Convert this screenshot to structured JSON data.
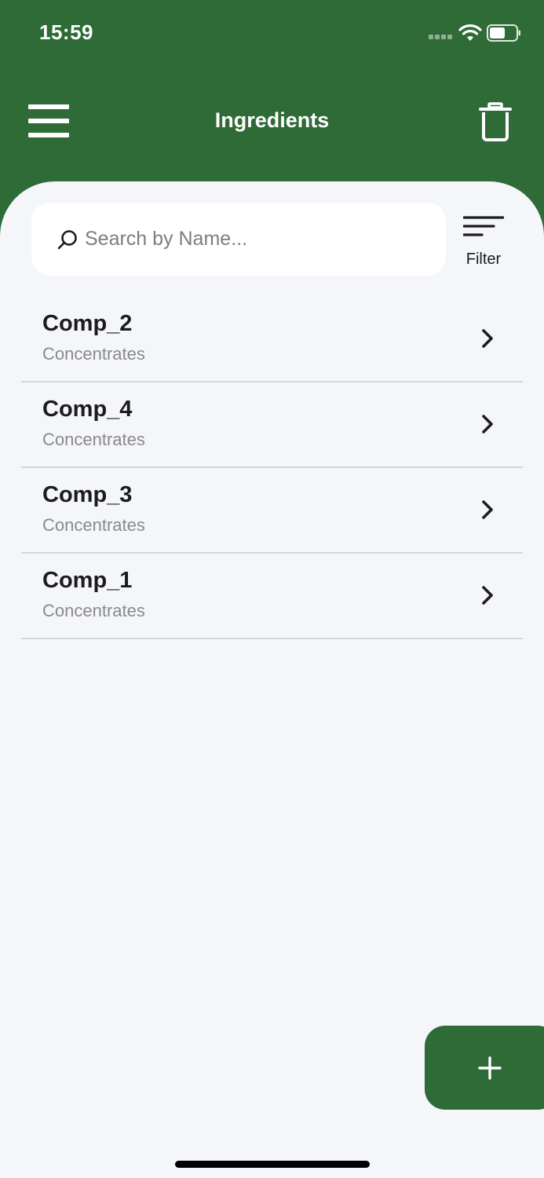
{
  "status_bar": {
    "time": "15:59"
  },
  "header": {
    "title": "Ingredients"
  },
  "search": {
    "placeholder": "Search by Name..."
  },
  "filter": {
    "label": "Filter"
  },
  "ingredients": [
    {
      "name": "Comp_2",
      "category": "Concentrates"
    },
    {
      "name": "Comp_4",
      "category": "Concentrates"
    },
    {
      "name": "Comp_3",
      "category": "Concentrates"
    },
    {
      "name": "Comp_1",
      "category": "Concentrates"
    }
  ],
  "icons": {
    "menu": "menu-icon",
    "delete": "trash-icon",
    "search": "search-icon",
    "filter": "filter-icon",
    "row": "chevron-right-icon",
    "add": "plus-icon"
  },
  "colors": {
    "brand": "#2e6b37",
    "background": "#f4f6fa",
    "text_primary": "#1c1c1e",
    "text_secondary": "#8a8a8e"
  }
}
